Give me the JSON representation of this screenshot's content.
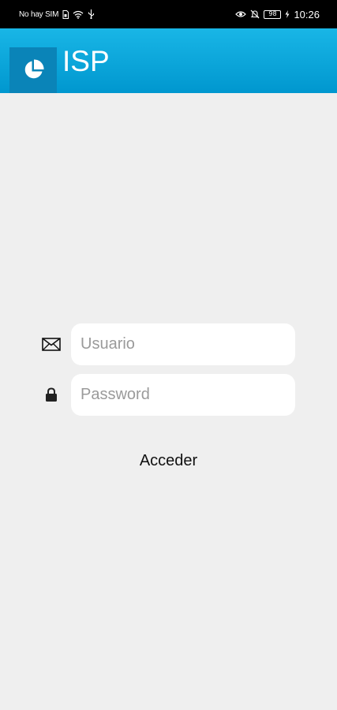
{
  "status_bar": {
    "carrier": "No hay SIM",
    "battery": "98",
    "time": "10:26",
    "icons": [
      "sim-card-icon",
      "wifi-icon",
      "usb-icon",
      "eye-icon",
      "bell-off-icon",
      "battery-icon",
      "charging-icon"
    ]
  },
  "app_bar": {
    "title": "ISP",
    "logo_icon": "pie-chart-icon",
    "background": "#0aa6da",
    "logo_background": "#0a84b8"
  },
  "login": {
    "username_placeholder": "Usuario",
    "username_value": "",
    "username_icon": "envelope-icon",
    "password_placeholder": "Password",
    "password_value": "",
    "password_icon": "lock-icon",
    "submit_label": "Acceder"
  },
  "colors": {
    "page_background": "#efefef",
    "field_background": "#ffffff",
    "placeholder": "#9a9a9a"
  }
}
